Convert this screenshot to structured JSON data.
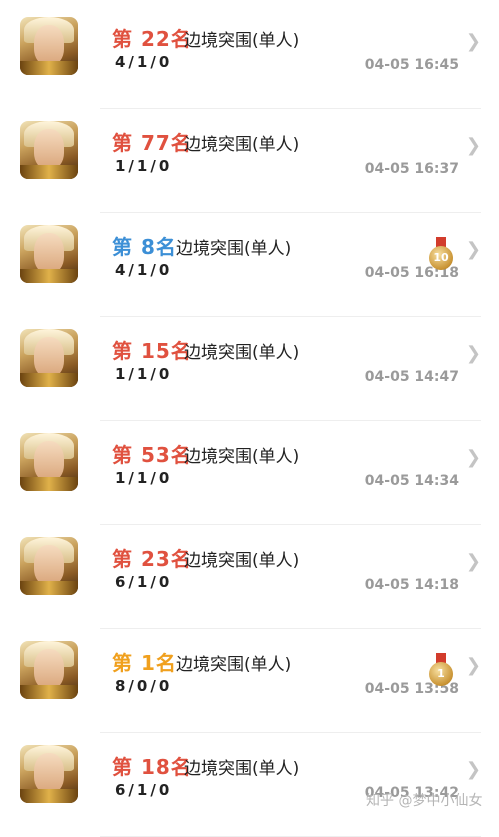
{
  "colors": {
    "rank_red": "#e0513f",
    "rank_blue": "#3c8fd6",
    "rank_orange": "#f0a01e"
  },
  "matches": [
    {
      "rank": "第 22名",
      "rank_color": "#e0513f",
      "mode": "边境突围(单人)",
      "kda": "4/1/0",
      "time": "04-05 16:45",
      "medal": null
    },
    {
      "rank": "第 77名",
      "rank_color": "#e0513f",
      "mode": "边境突围(单人)",
      "kda": "1/1/0",
      "time": "04-05 16:37",
      "medal": null
    },
    {
      "rank": "第 8名",
      "rank_color": "#3c8fd6",
      "mode": "边境突围(单人)",
      "kda": "4/1/0",
      "time": "04-05 16:18",
      "medal": "10"
    },
    {
      "rank": "第 15名",
      "rank_color": "#e0513f",
      "mode": "边境突围(单人)",
      "kda": "1/1/0",
      "time": "04-05 14:47",
      "medal": null
    },
    {
      "rank": "第 53名",
      "rank_color": "#e0513f",
      "mode": "边境突围(单人)",
      "kda": "1/1/0",
      "time": "04-05 14:34",
      "medal": null
    },
    {
      "rank": "第 23名",
      "rank_color": "#e0513f",
      "mode": "边境突围(单人)",
      "kda": "6/1/0",
      "time": "04-05 14:18",
      "medal": null
    },
    {
      "rank": "第 1名",
      "rank_color": "#f0a01e",
      "mode": "边境突围(单人)",
      "kda": "8/0/0",
      "time": "04-05 13:58",
      "medal": "1"
    },
    {
      "rank": "第 18名",
      "rank_color": "#e0513f",
      "mode": "边境突围(单人)",
      "kda": "6/1/0",
      "time": "04-05 13:42",
      "medal": null
    }
  ],
  "watermark": "知乎 @梦中小仙女"
}
